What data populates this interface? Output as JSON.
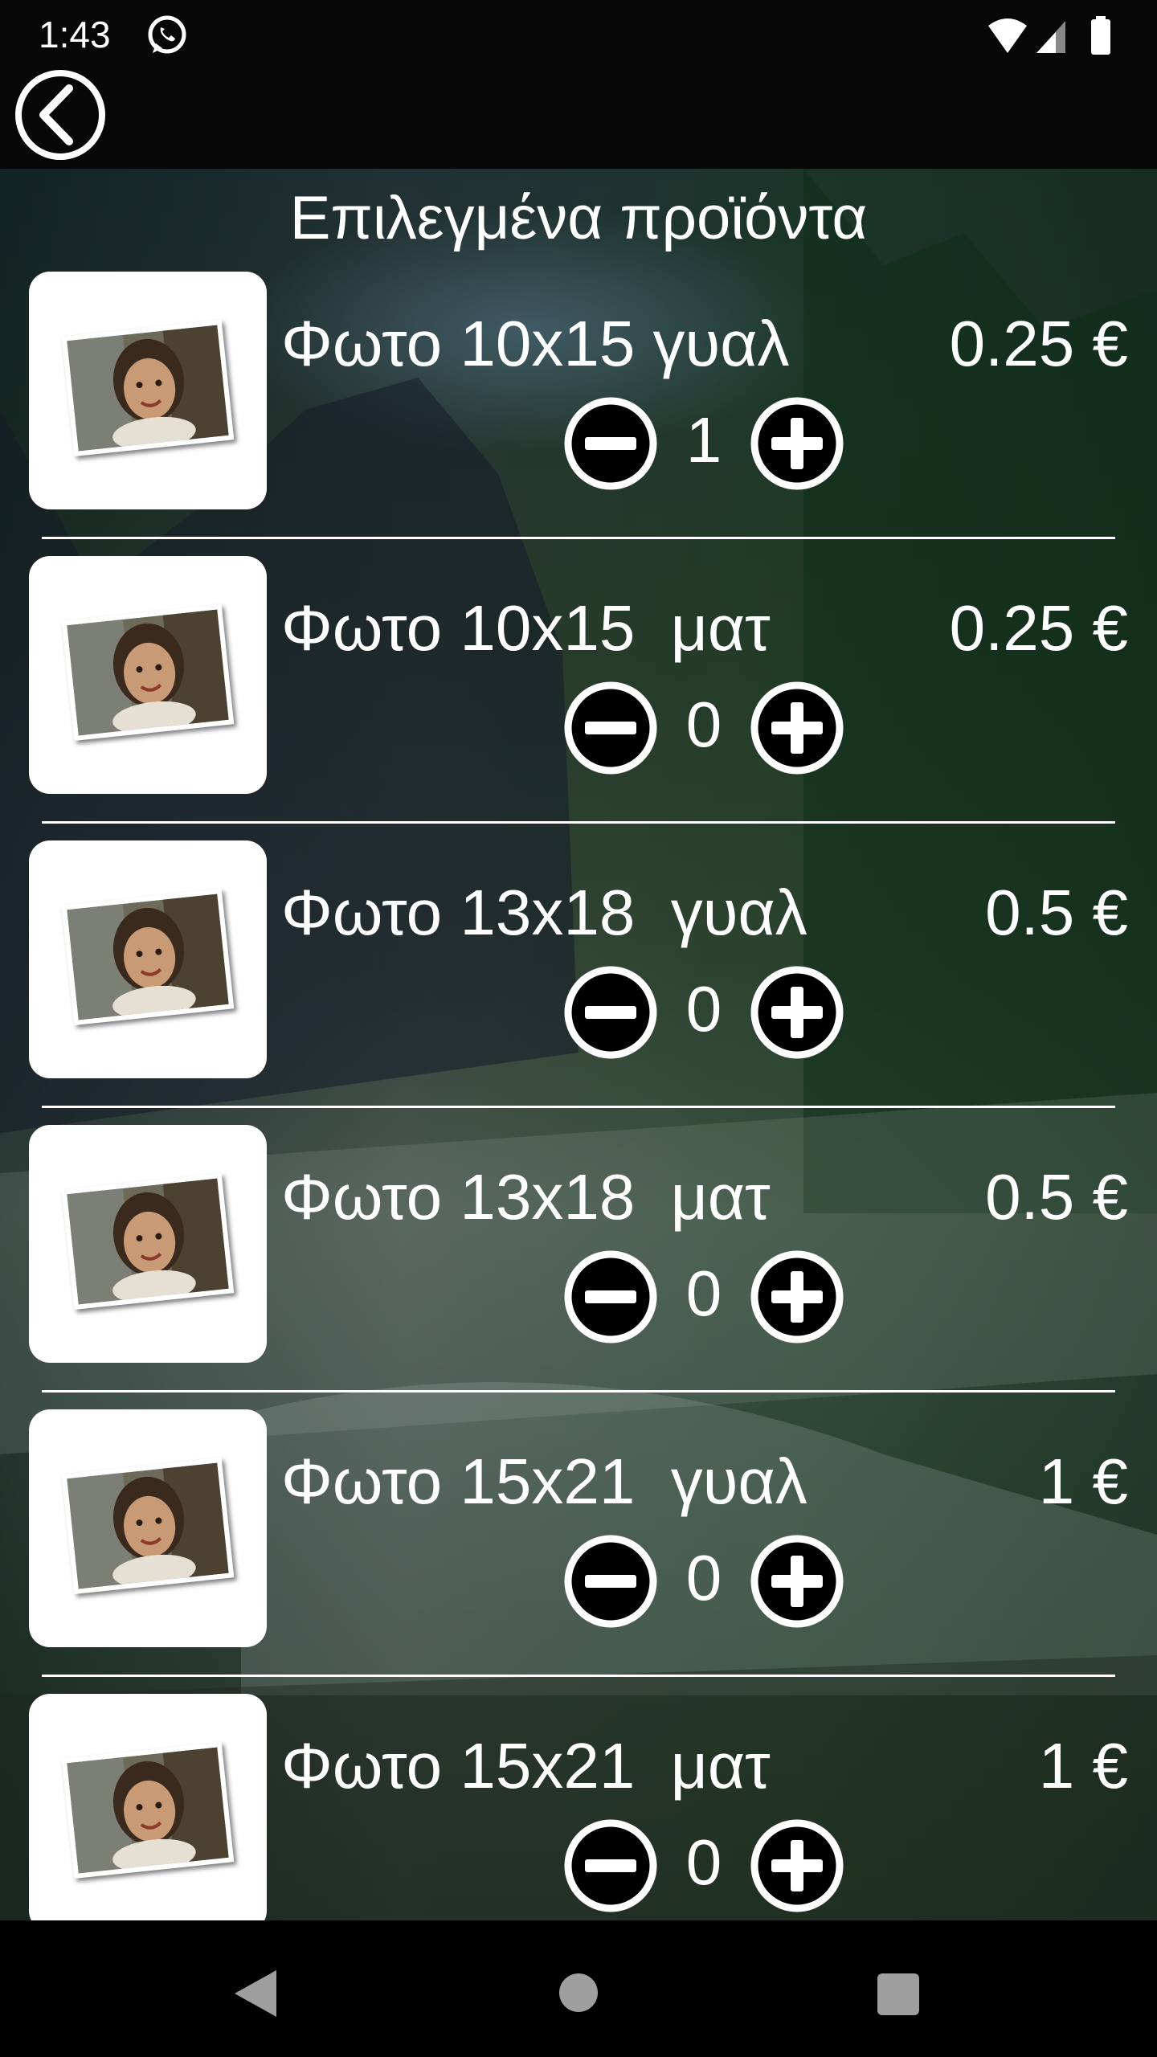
{
  "status_bar": {
    "time": "1:43",
    "icons": [
      "whatsapp-icon",
      "wifi-icon",
      "signal-icon",
      "battery-icon"
    ]
  },
  "header": {
    "back_icon": "chevron-left-circle-icon"
  },
  "title": "Επιλεγμένα προϊόντα",
  "products": [
    {
      "name": "Φωτο 10x15 γυαλ",
      "price": "0.25 €",
      "quantity": "1"
    },
    {
      "name": "Φωτο 10x15  ματ",
      "price": "0.25 €",
      "quantity": "0"
    },
    {
      "name": "Φωτο 13x18  γυαλ",
      "price": "0.5 €",
      "quantity": "0"
    },
    {
      "name": "Φωτο 13x18  ματ",
      "price": "0.5 €",
      "quantity": "0"
    },
    {
      "name": "Φωτο 15x21  γυαλ",
      "price": "1 €",
      "quantity": "0"
    },
    {
      "name": "Φωτο 15x21  ματ",
      "price": "1 €",
      "quantity": "0"
    }
  ],
  "nav_bar": {
    "icons": [
      "nav-back-icon",
      "nav-home-icon",
      "nav-recents-icon"
    ]
  }
}
